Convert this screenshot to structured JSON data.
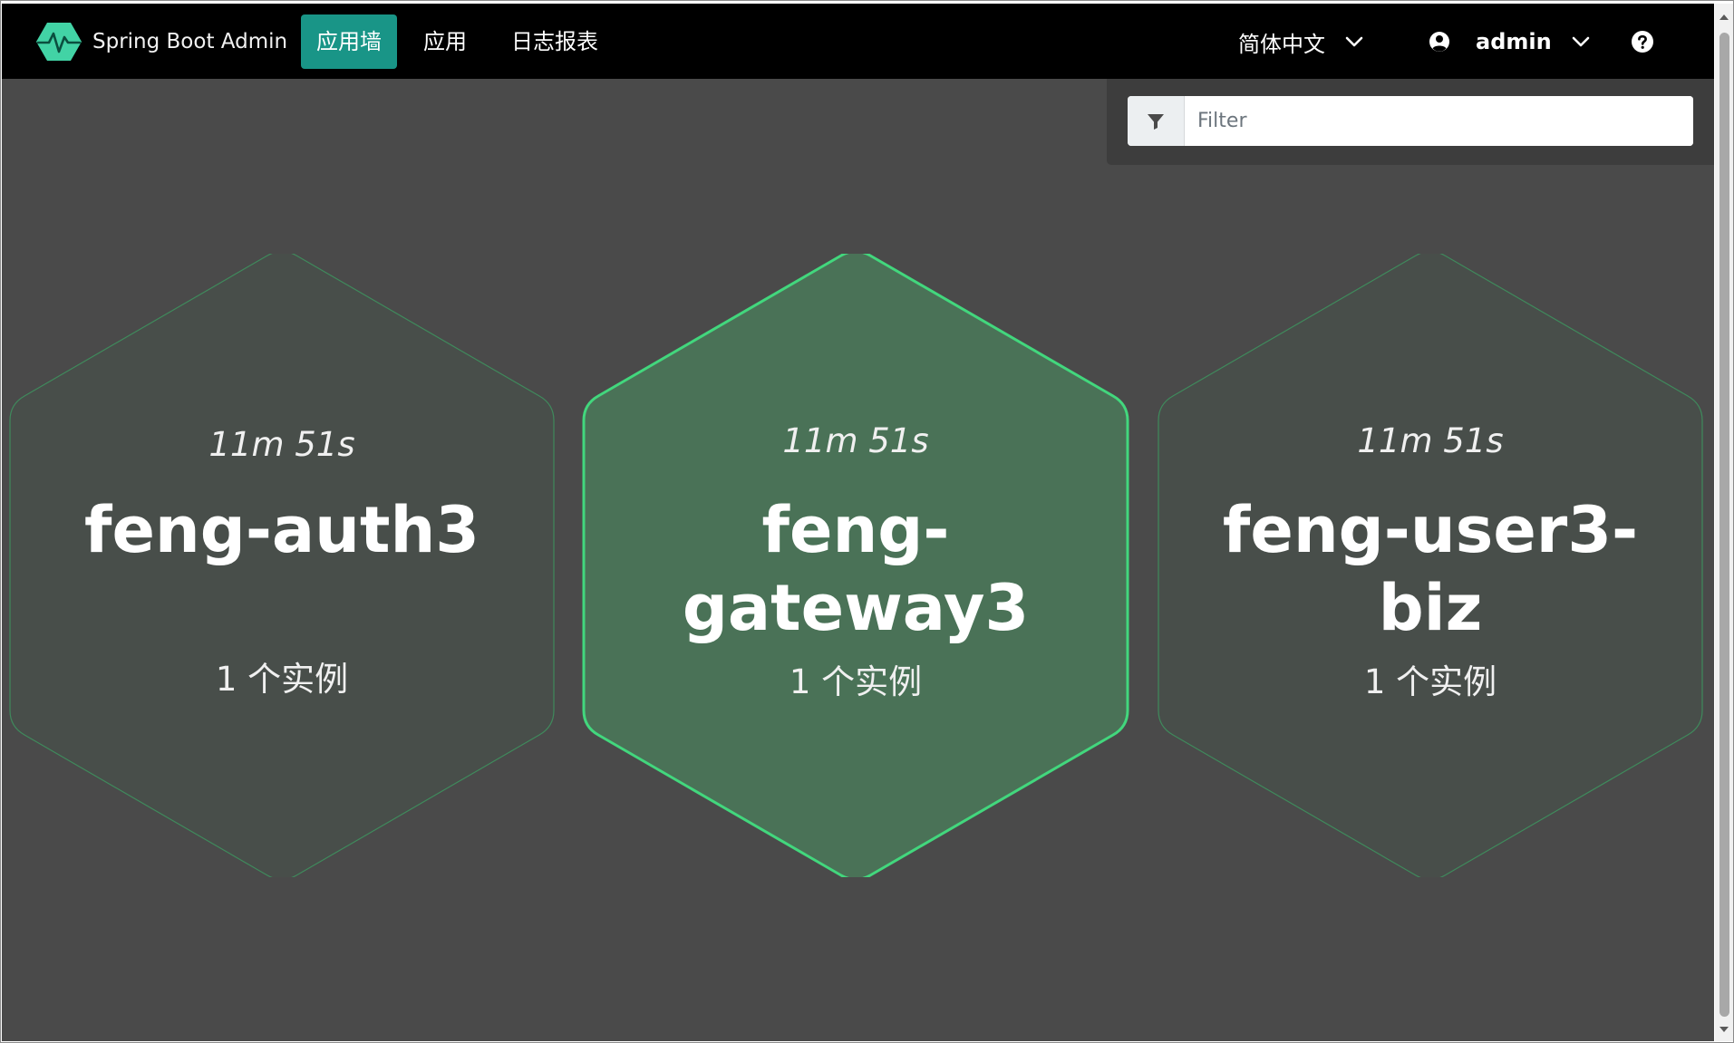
{
  "navbar": {
    "brand": "Spring Boot Admin",
    "links": [
      {
        "label": "应用墙",
        "active": true
      },
      {
        "label": "应用",
        "active": false
      },
      {
        "label": "日志报表",
        "active": false
      }
    ],
    "language": "简体中文",
    "user": "admin",
    "icons": {
      "logo": "heartbeat-hex-logo",
      "user": "user-circle-icon",
      "help": "question-circle-icon",
      "dropdown": "chevron-down-icon"
    }
  },
  "filter": {
    "placeholder": "Filter",
    "value": "",
    "icon": "filter-icon"
  },
  "applications": [
    {
      "uptime": "11m 51s",
      "name": "feng-auth3",
      "instances": "1 个实例",
      "selected": false
    },
    {
      "uptime": "11m 51s",
      "name": "feng-gateway3",
      "instances": "1 个实例",
      "selected": true
    },
    {
      "uptime": "11m 51s",
      "name": "feng-user3-biz",
      "instances": "1 个实例",
      "selected": false
    }
  ],
  "colors": {
    "navbar_bg": "#000000",
    "accent": "#199587",
    "page_bg": "#4a4a4a",
    "status_up": "#42d77d",
    "hex_fill": "#484e4a",
    "hex_fill_selected": "#4a7257"
  }
}
